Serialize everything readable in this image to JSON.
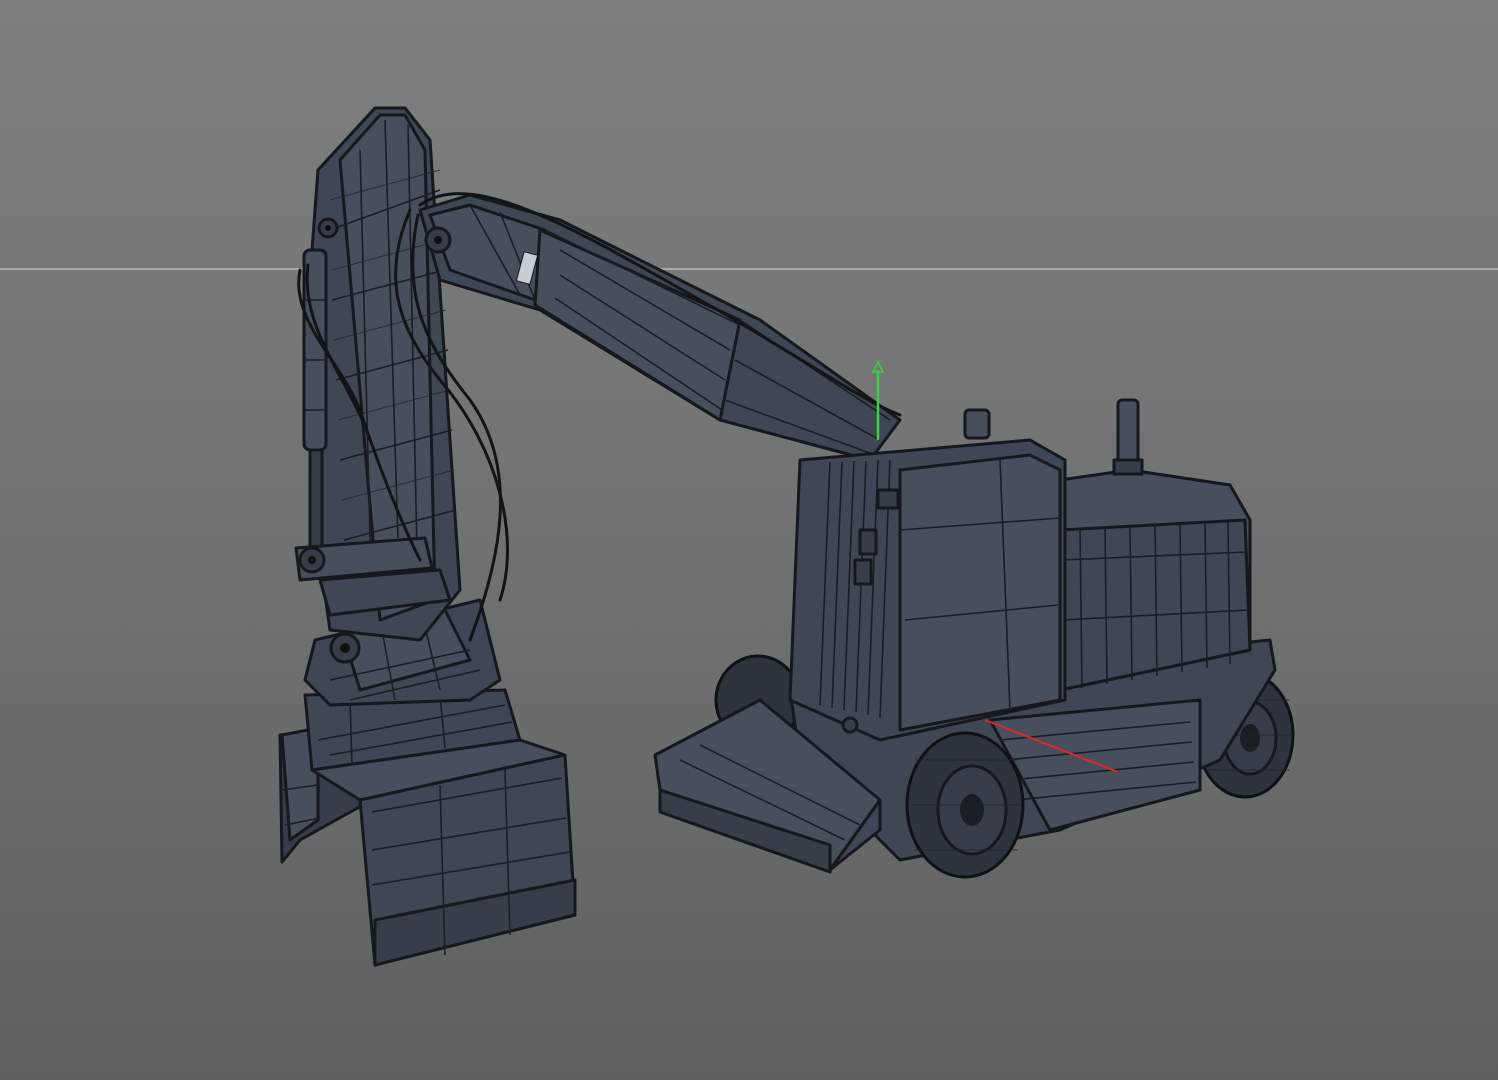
{
  "viewport": {
    "background_top": "#7e7e7e",
    "background_bottom": "#5f5f5f",
    "horizon_color": "#a9a9a9",
    "model_color": "#3f4754",
    "wire_color": "#15181d",
    "y_axis_color": "#37d23c",
    "x_axis_color": "#e0282c"
  }
}
